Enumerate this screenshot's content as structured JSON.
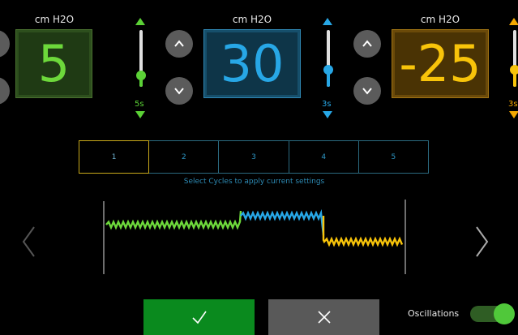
{
  "unit_left": "cm H2O",
  "unit_mid": "cm H2O",
  "unit_right": "cm H2O",
  "values": {
    "green": "5",
    "blue": "30",
    "orange": "-25"
  },
  "sliders": {
    "green_label": "5s",
    "blue_label": "3s",
    "orange_label": "3s"
  },
  "cycles": [
    "1",
    "2",
    "3",
    "4",
    "5"
  ],
  "selected_cycle": "1",
  "hint": "Select Cycles to apply current settings",
  "oscillations_label": "Oscillations",
  "oscillations_on": true,
  "colors": {
    "green": "#6dd83b",
    "blue": "#27a7e6",
    "orange": "#f8c40a",
    "confirm": "#0a8a1e",
    "cancel": "#595959"
  },
  "icons": [
    "chevron-up-icon",
    "chevron-down-icon",
    "checkmark-icon",
    "close-icon",
    "chevron-left-icon",
    "chevron-right-icon"
  ]
}
